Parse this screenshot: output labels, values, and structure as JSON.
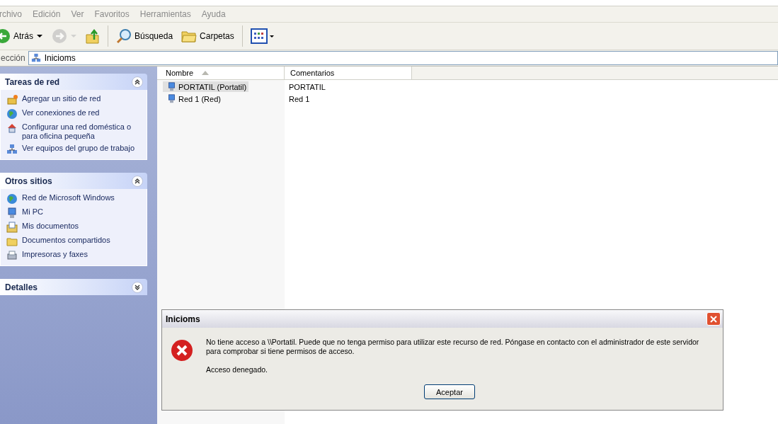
{
  "menu": [
    "rchivo",
    "Edición",
    "Ver",
    "Favoritos",
    "Herramientas",
    "Ayuda"
  ],
  "toolbar": [
    {
      "kind": "back",
      "label": "Atrás",
      "disabled": false
    },
    {
      "kind": "forward",
      "disabled": true
    },
    {
      "kind": "up",
      "disabled": false
    },
    {
      "kind": "separator"
    },
    {
      "kind": "search",
      "label": "Búsqueda",
      "disabled": false
    },
    {
      "kind": "folders",
      "label": "Carpetas",
      "disabled": false
    },
    {
      "kind": "separator"
    },
    {
      "kind": "views",
      "disabled": false
    }
  ],
  "address": {
    "label": "ección",
    "value": "Inicioms"
  },
  "sidebar": [
    {
      "title": "Tareas de red",
      "expanded": true,
      "items": [
        {
          "kind": "add",
          "label": "Agregar un sitio de red"
        },
        {
          "kind": "globe",
          "label": "Ver conexiones de red"
        },
        {
          "kind": "home",
          "label": "Configurar una red doméstica o para oficina pequeña"
        },
        {
          "kind": "network",
          "label": "Ver equipos del grupo de trabajo"
        }
      ]
    },
    {
      "title": "Otros sitios",
      "expanded": true,
      "items": [
        {
          "kind": "globe",
          "label": "Red de Microsoft Windows"
        },
        {
          "kind": "computer",
          "label": "Mi PC"
        },
        {
          "kind": "docs",
          "label": "Mis documentos"
        },
        {
          "kind": "folder",
          "label": "Documentos compartidos"
        },
        {
          "kind": "printer",
          "label": "Impresoras y faxes"
        }
      ]
    },
    {
      "title": "Detalles",
      "expanded": false
    }
  ],
  "table": {
    "columns": [
      {
        "label": "Nombre",
        "sorted": true
      },
      {
        "label": "Comentarios",
        "sorted": false
      }
    ],
    "rows": [
      {
        "name": "PORTATIL (Portatil)",
        "comment": "PORTATIL",
        "selected": true
      },
      {
        "name": "Red 1 (Red)",
        "comment": "Red 1",
        "selected": false
      }
    ]
  },
  "dialog": {
    "title": "Inicioms",
    "messages": [
      "No tiene acceso a \\\\Portatil. Puede que no tenga permiso para utilizar este recurso de red. Póngase en contacto con el administrador de este servidor para comprobar si tiene permisos de acceso.",
      "Acceso denegado."
    ],
    "button": "Aceptar"
  }
}
